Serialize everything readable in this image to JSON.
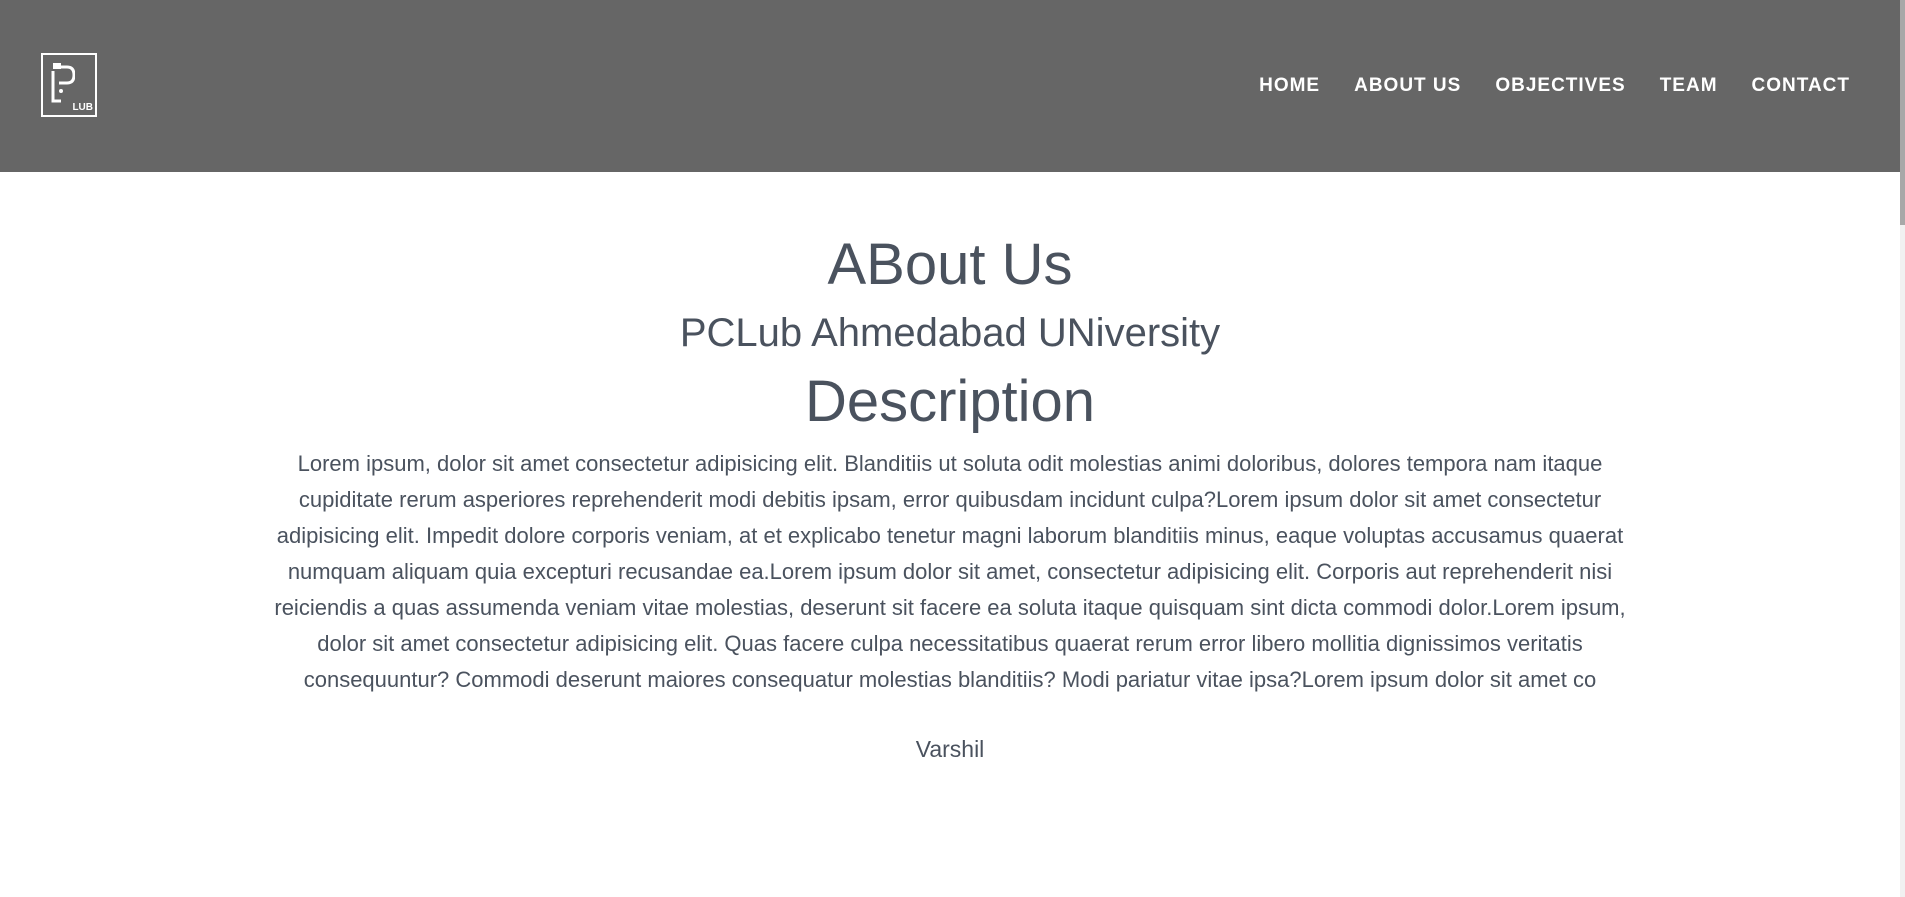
{
  "header": {
    "logo_text": "LUB",
    "nav": [
      "HOME",
      "ABOUT US",
      "OBJECTIVES",
      "TEAM",
      "CONTACT"
    ]
  },
  "main": {
    "title": "ABout Us",
    "subtitle": "PCLub Ahmedabad UNiversity",
    "section_title": "Description",
    "description": "Lorem ipsum, dolor sit amet consectetur adipisicing elit. Blanditiis ut soluta odit molestias animi doloribus, dolores tempora nam itaque cupiditate rerum asperiores reprehenderit modi debitis ipsam, error quibusdam incidunt culpa?Lorem ipsum dolor sit amet consectetur adipisicing elit. Impedit dolore corporis veniam, at et explicabo tenetur magni laborum blanditiis minus, eaque voluptas accusamus quaerat numquam aliquam quia excepturi recusandae ea.Lorem ipsum dolor sit amet, consectetur adipisicing elit. Corporis aut reprehenderit nisi reiciendis a quas assumenda veniam vitae molestias, deserunt sit facere ea soluta itaque quisquam sint dicta commodi dolor.Lorem ipsum, dolor sit amet consectetur adipisicing elit. Quas facere culpa necessitatibus quaerat rerum error libero mollitia dignissimos veritatis consequuntur? Commodi deserunt maiores consequatur molestias blanditiis? Modi pariatur vitae ipsa?Lorem ipsum dolor sit amet co",
    "author": "Varshil"
  },
  "colors": {
    "navbar_bg": "#666666",
    "text": "#4a525e",
    "nav_text": "#ffffff"
  }
}
